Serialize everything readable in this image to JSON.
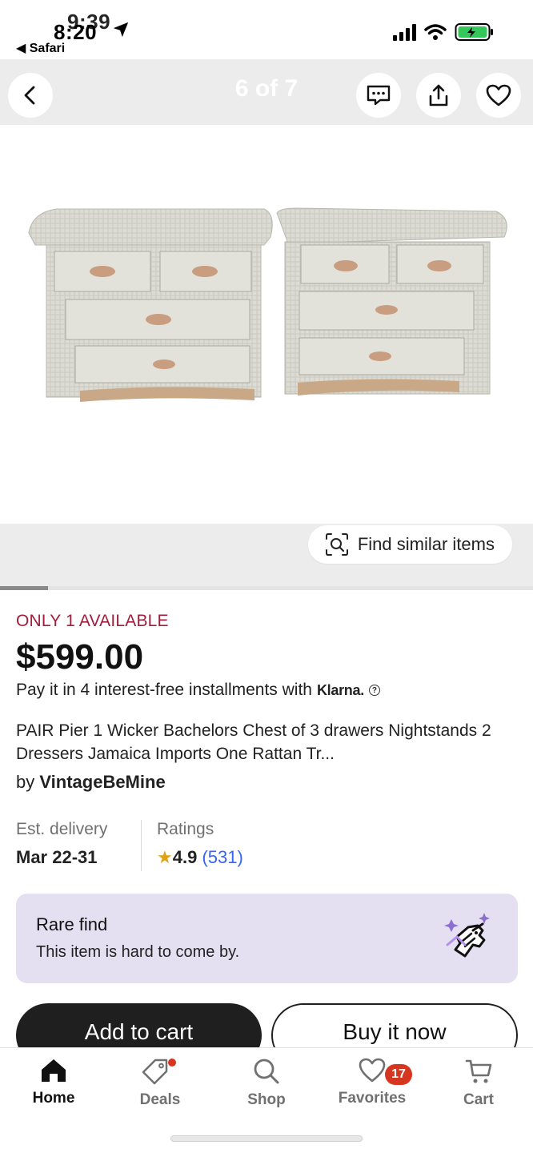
{
  "status_bar": {
    "time": "8:20",
    "time_ghost": "9:39",
    "back_app": "◀ Safari"
  },
  "gallery": {
    "counter": "6 of 7",
    "find_similar_label": "Find similar items",
    "image_position_fraction": 0.09
  },
  "listing": {
    "availability": "ONLY 1 AVAILABLE",
    "price": "$599.00",
    "installments_text": "Pay it in 4 interest-free installments with",
    "installments_provider": "Klarna.",
    "title": "PAIR Pier 1 Wicker Bachelors Chest of 3 drawers Nightstands 2 Dressers Jamaica Imports One Rattan Tr...",
    "seller_prefix": "by",
    "seller_name": "VintageBeMine"
  },
  "delivery": {
    "label": "Est. delivery",
    "value": "Mar 22-31"
  },
  "ratings": {
    "label": "Ratings",
    "star": "★",
    "score": "4.9",
    "count": "(531)"
  },
  "rare_find": {
    "title": "Rare find",
    "subtitle": "This item is hard to come by."
  },
  "actions": {
    "add_to_cart": "Add to cart",
    "buy_now": "Buy it now"
  },
  "tabs": [
    {
      "label": "Home",
      "active": true
    },
    {
      "label": "Deals"
    },
    {
      "label": "Shop"
    },
    {
      "label": "Favorites",
      "badge": "17"
    },
    {
      "label": "Cart"
    }
  ],
  "colors": {
    "availability": "#a01e3c",
    "rating_link": "#3665f3",
    "rare_bg": "#e5e0f1",
    "badge": "#d6361f"
  }
}
